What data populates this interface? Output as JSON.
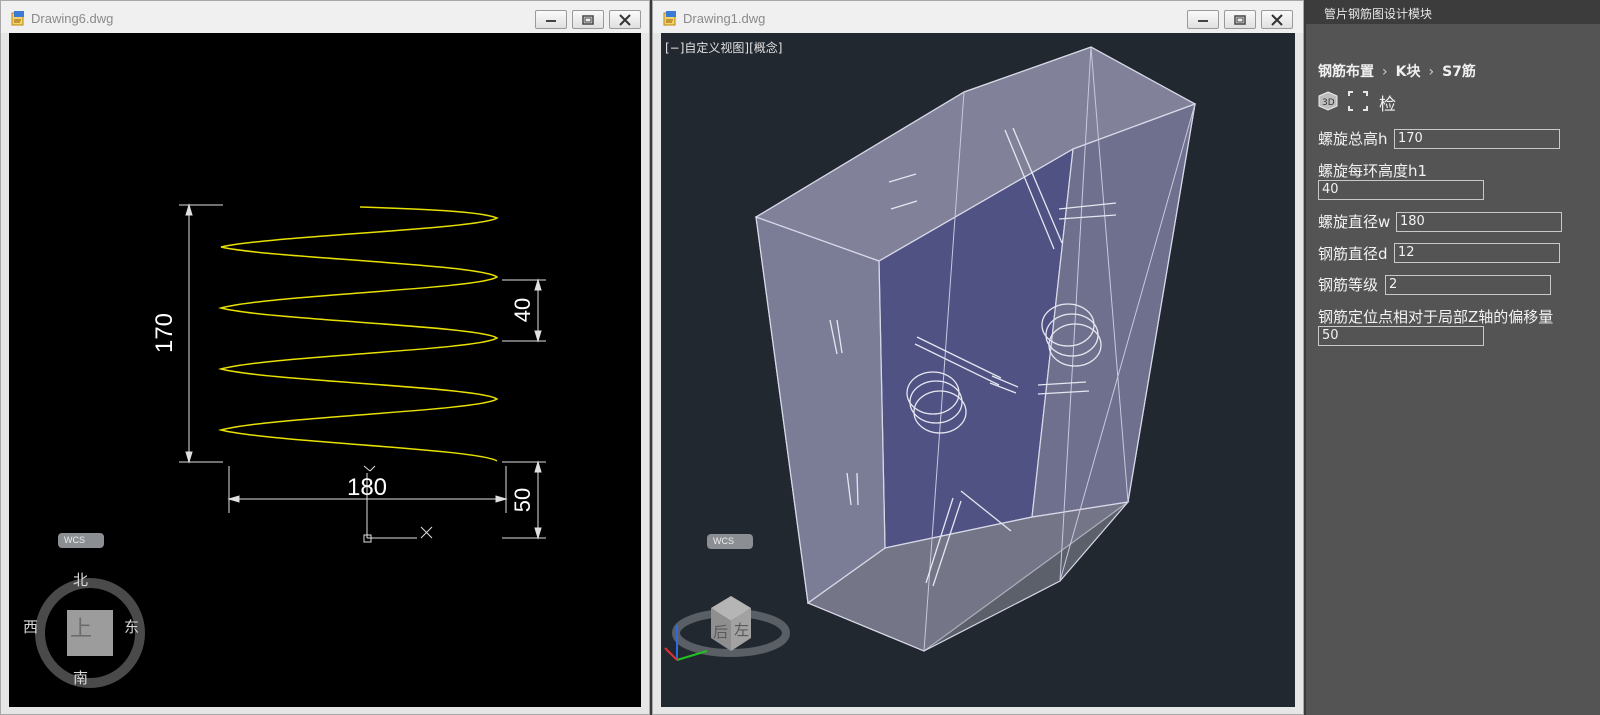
{
  "left_window": {
    "title": "Drawing6.dwg",
    "dimensions": {
      "height": "170",
      "pitch": "40",
      "diameter": "180",
      "offset": "50"
    },
    "wcs_label": "WCS",
    "compass": {
      "north": "北",
      "south": "南",
      "east": "东",
      "west": "西",
      "center": "上"
    }
  },
  "mid_window": {
    "title": "Drawing1.dwg",
    "view_label": "[−]自定义视图][概念]",
    "wcs_label": "WCS",
    "viewcube": {
      "face_back": "后",
      "face_left": "左"
    }
  },
  "panel": {
    "title": "管片钢筋图设计模块",
    "breadcrumb": [
      "钢筋布置",
      "K块",
      "S7筋"
    ],
    "check_label": "检",
    "fields": [
      {
        "label": "螺旋总高h",
        "value": "170"
      },
      {
        "label": "螺旋每环高度h1",
        "value": "40"
      },
      {
        "label": "螺旋直径w",
        "value": "180"
      },
      {
        "label": "钢筋直径d",
        "value": "12"
      },
      {
        "label": "钢筋等级",
        "value": "2"
      },
      {
        "label": "钢筋定位点相对于局部Z轴的偏移量",
        "value": "50"
      }
    ]
  },
  "colors": {
    "helix": "#e8e000",
    "canvas_left": "#000000",
    "canvas_3d": "#212830",
    "panel_bg": "#545454"
  }
}
